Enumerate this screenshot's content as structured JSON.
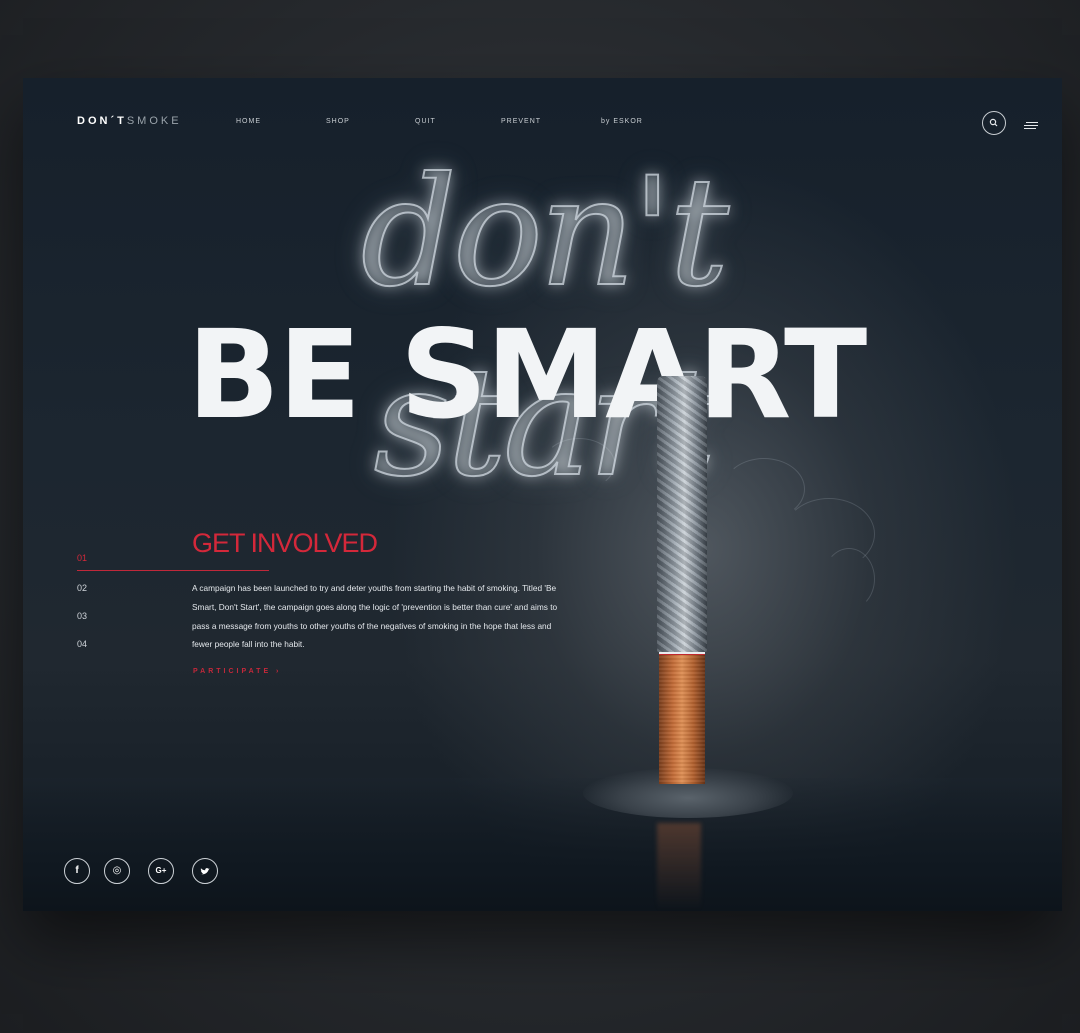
{
  "header": {
    "logo_bold": "DON´T",
    "logo_light": "SMOKE",
    "nav": [
      "HOME",
      "SHOP",
      "QUIT",
      "PREVENT",
      "by ESKOR"
    ]
  },
  "hero": {
    "smoke_title": "don't start",
    "title": "BE SMART"
  },
  "pager": [
    "01",
    "02",
    "03",
    "04"
  ],
  "pager_active_index": 0,
  "content": {
    "title": "GET INVOLVED",
    "description": "A campaign has been launched to try and deter youths from starting the habit of smoking. Titled 'Be Smart, Don't Start', the campaign goes along the logic of 'prevention is better than cure' and aims to pass a message from youths to other youths of the negatives of smoking in the hope that less and fewer people fall into the habit.",
    "cta": "PARTICIPATE ›"
  },
  "socials": [
    {
      "name": "facebook-icon",
      "glyph": "f"
    },
    {
      "name": "instagram-icon",
      "glyph": "◎"
    },
    {
      "name": "google-plus-icon",
      "glyph": "G+"
    },
    {
      "name": "twitter-icon",
      "glyph": "🐦"
    }
  ],
  "colors": {
    "accent": "#d4283a",
    "background": "#1c2630",
    "text": "#f2f4f6"
  }
}
